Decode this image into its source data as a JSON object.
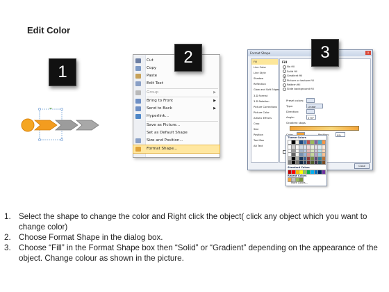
{
  "slide": {
    "title": "Edit Color"
  },
  "steps": {
    "badge_1": "1",
    "badge_2": "2",
    "badge_3": "3"
  },
  "context_menu": {
    "items": [
      {
        "label": "Cut",
        "icon": "scissors-icon",
        "disabled": false
      },
      {
        "label": "Copy",
        "icon": "copy-icon",
        "disabled": false
      },
      {
        "label": "Paste",
        "icon": "paste-icon",
        "disabled": false
      },
      {
        "label": "Edit Text",
        "icon": "edit-text-icon",
        "disabled": false
      },
      {
        "label": "Group",
        "icon": "group-icon",
        "disabled": true
      },
      {
        "label": "Bring to Front",
        "icon": "bring-front-icon",
        "disabled": false
      },
      {
        "label": "Send to Back",
        "icon": "send-back-icon",
        "disabled": false
      },
      {
        "label": "Hyperlink...",
        "icon": "hyperlink-icon",
        "disabled": false
      },
      {
        "label": "Save as Picture...",
        "icon": "",
        "disabled": false
      },
      {
        "label": "Set as Default Shape",
        "icon": "",
        "disabled": false
      },
      {
        "label": "Size and Position...",
        "icon": "size-position-icon",
        "disabled": false
      },
      {
        "label": "Format Shape...",
        "icon": "format-shape-icon",
        "disabled": false
      }
    ],
    "highlight_color": "#ffe7a0"
  },
  "format_dialog": {
    "title": "Format Shape",
    "close": "x",
    "categories": [
      "Fill",
      "Line Color",
      "Line Style",
      "Shadow",
      "Reflection",
      "Glow and Soft Edges",
      "3-D Format",
      "3-D Rotation",
      "Picture Corrections",
      "Picture Color",
      "Artistic Effects",
      "Crop",
      "Size",
      "Position",
      "Text Box",
      "Alt Text"
    ],
    "selected_category": "Fill",
    "panel_heading": "Fill",
    "fill_options": [
      "No fill",
      "Solid fill",
      "Gradient fill",
      "Picture or texture fill",
      "Pattern fill",
      "Slide background fill"
    ],
    "fill_selected_index": 2,
    "fields": {
      "preset_colors": "Preset colors:",
      "type": "Type:",
      "type_value": "Linear",
      "direction": "Direction:",
      "angle": "Angle:",
      "angle_value": "270°",
      "gradient_stops": "Gradient stops",
      "color": "Color",
      "position": "Position:",
      "position_value": "0%",
      "brightness": "Brightness:",
      "transparency": "Transparency:",
      "rotate": "Rotate with shape"
    },
    "close_button": "Close"
  },
  "color_palette": {
    "theme_colors": "Theme Colors",
    "standard_colors": "Standard Colors",
    "recent_colors": "Recent Colors",
    "more_colors": "More Colors...",
    "theme_row": [
      "#ffffff",
      "#000000",
      "#eeece1",
      "#1f497d",
      "#4f81bd",
      "#c0504d",
      "#9bbb59",
      "#8064a2",
      "#4bacc6",
      "#f79646"
    ],
    "standard_row": [
      "#c00000",
      "#ff0000",
      "#ffc000",
      "#ffff00",
      "#92d050",
      "#00b050",
      "#00b0f0",
      "#0070c0",
      "#002060",
      "#7030a0"
    ],
    "recent_row": [
      "#f4a53a",
      "#bfbfbf",
      "#9bbb59",
      "#77933c"
    ]
  },
  "shapes": {
    "circle_color": "#f5a623",
    "active_arrow_color": "#f39c1f",
    "gray_arrow_color": "#9c9c9c"
  },
  "instructions": [
    {
      "num": "1.",
      "text": "Select the shape to change the color and Right click the object( click any object which you want to change color)"
    },
    {
      "num": "2.",
      "text": "Choose Format Shape in the dialog box."
    },
    {
      "num": "3.",
      "text": "Choose “Fill” in the Format Shape box then “Solid” or “Gradient” depending on the appearance of the object. Change colour as shown in the picture."
    }
  ]
}
